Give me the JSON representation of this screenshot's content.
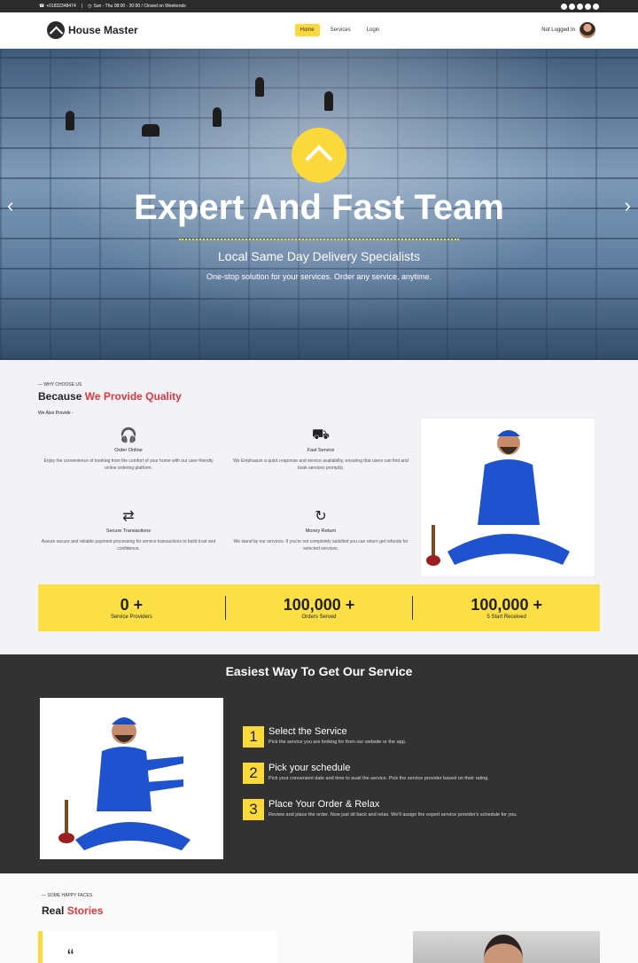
{
  "topbar": {
    "phone": "+01832348474",
    "hours": "Sun - Thu 08:00 - 20:00 / Closed on Weekends",
    "social": [
      "twitter-icon",
      "facebook-icon",
      "pinterest-icon",
      "youtube-icon",
      "dribbble-icon"
    ]
  },
  "nav": {
    "brand": "House Master",
    "items": [
      "Home",
      "Services",
      "Login"
    ],
    "status": "Not Logged In"
  },
  "hero": {
    "title": "Expert And Fast Team",
    "subtitle": "Local Same Day Delivery Specialists",
    "tagline": "One-stop solution for your services. Order any service, anytime."
  },
  "why": {
    "eyebrow": "WHY CHOOSE US",
    "title_a": "Because ",
    "title_b": "We Provide Quality",
    "also": "We Also Provide -",
    "features": [
      {
        "title": "Order Online",
        "desc": "Enjoy the convenience of booking from the comfort of your home with our user-friendly online ordering platform."
      },
      {
        "title": "Fast Service",
        "desc": "We Emphasize a quick response and service availability, ensuring that users can find and book services promptly."
      },
      {
        "title": "Secure Transactions",
        "desc": "Assure secure and reliable payment processing for service transactions to build trust and confidence."
      },
      {
        "title": "Money Return",
        "desc": "We stand by our services. If you're not completely satisfied you can return get refunds for selected services."
      }
    ],
    "stats": [
      {
        "number": "0 +",
        "label": "Service Providers"
      },
      {
        "number": "100,000 +",
        "label": "Orders Served"
      },
      {
        "number": "100,000 +",
        "label": "5 Start Received"
      }
    ]
  },
  "steps": {
    "title": "Easiest Way To Get Our Service",
    "items": [
      {
        "num": "1",
        "title": "Select the Service",
        "desc": "Pick the service you are looking for from our website or the app."
      },
      {
        "num": "2",
        "title": "Pick your schedule",
        "desc": "Pick your convenient date and time to avail the service. Pick the service provider based on their rating."
      },
      {
        "num": "3",
        "title": "Place Your Order & Relax",
        "desc": "Review and place the order. Now just sit back and relax. We'll assign the expert service provider's schedule for you."
      }
    ]
  },
  "stories": {
    "eyebrow": "SOME HAPPY FACES",
    "title_a": "Real ",
    "title_b": "Stories",
    "quote": "“"
  }
}
